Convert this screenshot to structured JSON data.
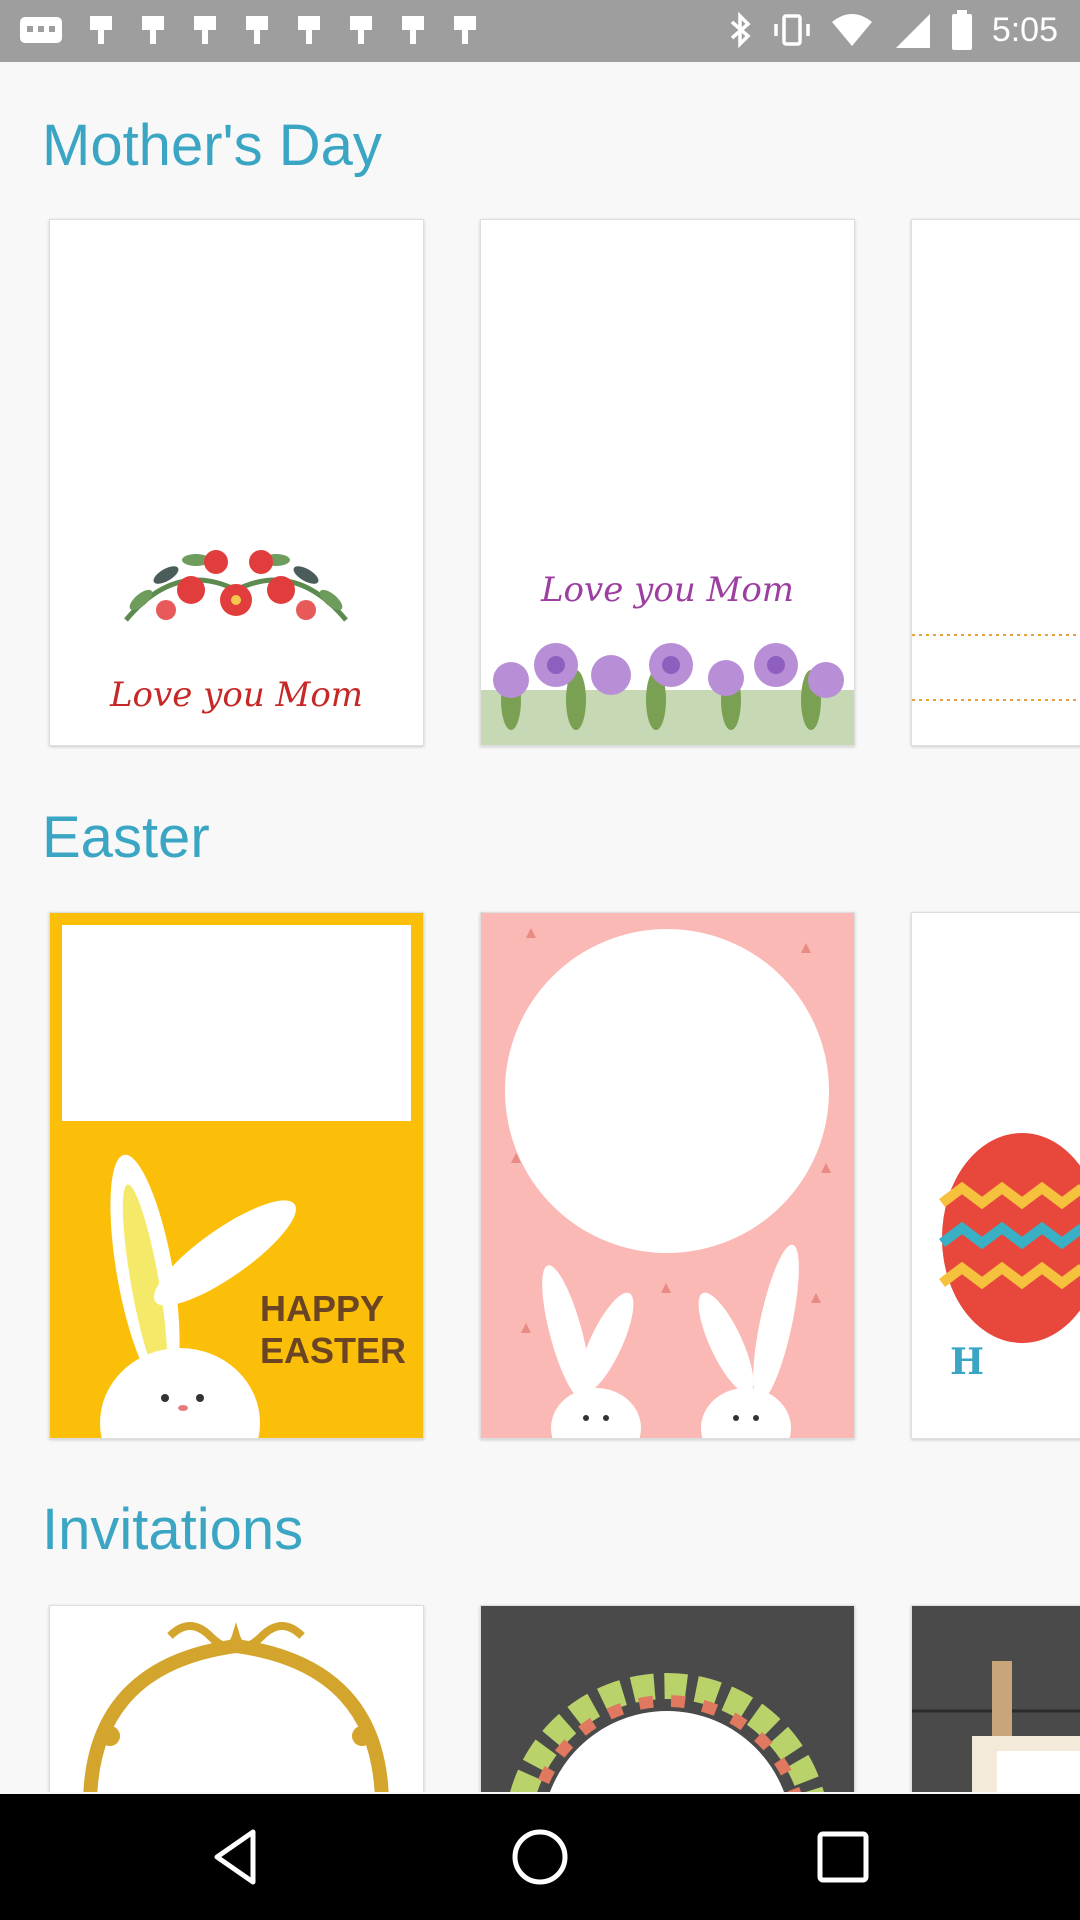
{
  "status_bar": {
    "time": "5:05",
    "left_icons": [
      "message-icon",
      "notification-icon",
      "notification-icon",
      "notification-icon",
      "notification-icon",
      "notification-icon",
      "notification-icon",
      "notification-icon",
      "notification-icon"
    ],
    "right_icons": [
      "bluetooth-icon",
      "vibrate-icon",
      "wifi-icon",
      "signal-icon",
      "battery-icon"
    ]
  },
  "sections": [
    {
      "title": "Mother's Day",
      "cards": [
        {
          "text": "Love you Mom"
        },
        {
          "text": "Love you Mom"
        },
        {
          "text": ""
        }
      ]
    },
    {
      "title": "Easter",
      "cards": [
        {
          "line1": "HAPPY",
          "line2": "EASTER"
        },
        {
          "text": ""
        },
        {
          "text": "H"
        }
      ]
    },
    {
      "title": "Invitations",
      "cards": [
        {
          "text": ""
        },
        {
          "text": ""
        },
        {
          "text": ""
        }
      ]
    }
  ],
  "nav": {
    "back": "back-icon",
    "home": "home-icon",
    "recents": "recents-icon"
  },
  "colors": {
    "accent": "#3aa6c4",
    "easter_yellow": "#fbbf0a",
    "easter_pink": "#fbb9b6",
    "invite_dark": "#4a4a4a"
  }
}
